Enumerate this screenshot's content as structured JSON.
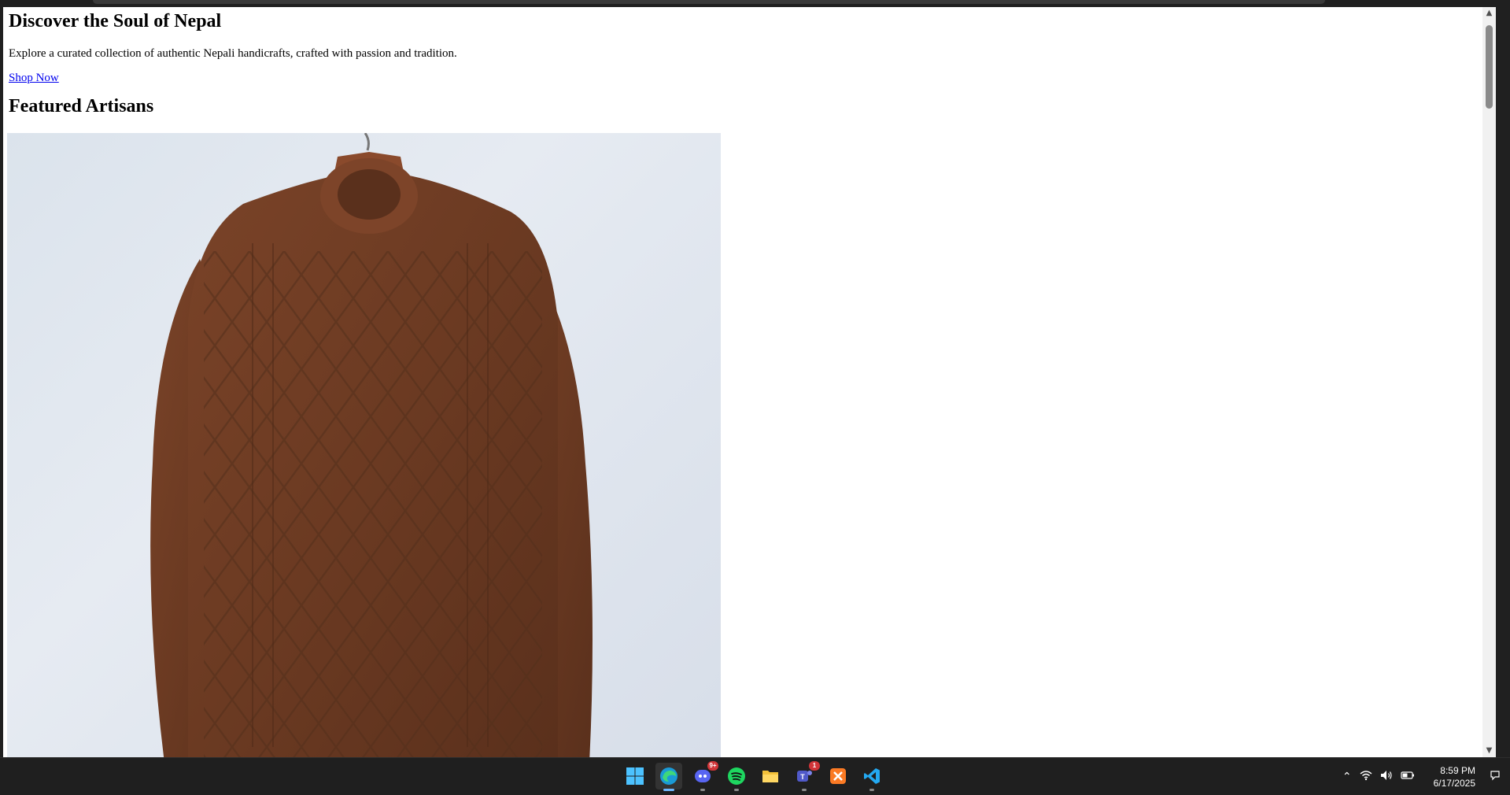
{
  "page": {
    "heading": "Discover the Soul of Nepal",
    "tagline": "Explore a curated collection of authentic Nepali handicrafts, crafted with passion and tradition.",
    "shop_link": "Shop Now",
    "section_heading": "Featured Artisans",
    "product_image": "brown-cable-knit-sweater-image"
  },
  "taskbar": {
    "apps": [
      {
        "name": "windows-start-icon",
        "active": false,
        "badge": ""
      },
      {
        "name": "edge-browser-icon",
        "active": true,
        "badge": ""
      },
      {
        "name": "discord-icon",
        "active": false,
        "badge": "9+"
      },
      {
        "name": "spotify-icon",
        "active": false,
        "badge": ""
      },
      {
        "name": "file-explorer-icon",
        "active": false,
        "badge": ""
      },
      {
        "name": "teams-icon",
        "active": false,
        "badge": "1"
      },
      {
        "name": "xampp-icon",
        "active": false,
        "badge": ""
      },
      {
        "name": "vscode-icon",
        "active": false,
        "badge": ""
      }
    ],
    "tray": {
      "time": "8:59 PM",
      "date": "6/17/2025"
    }
  },
  "colors": {
    "link": "#0000ee",
    "taskbar_bg": "#1f1f1f",
    "sweater": "#6b3a22"
  }
}
